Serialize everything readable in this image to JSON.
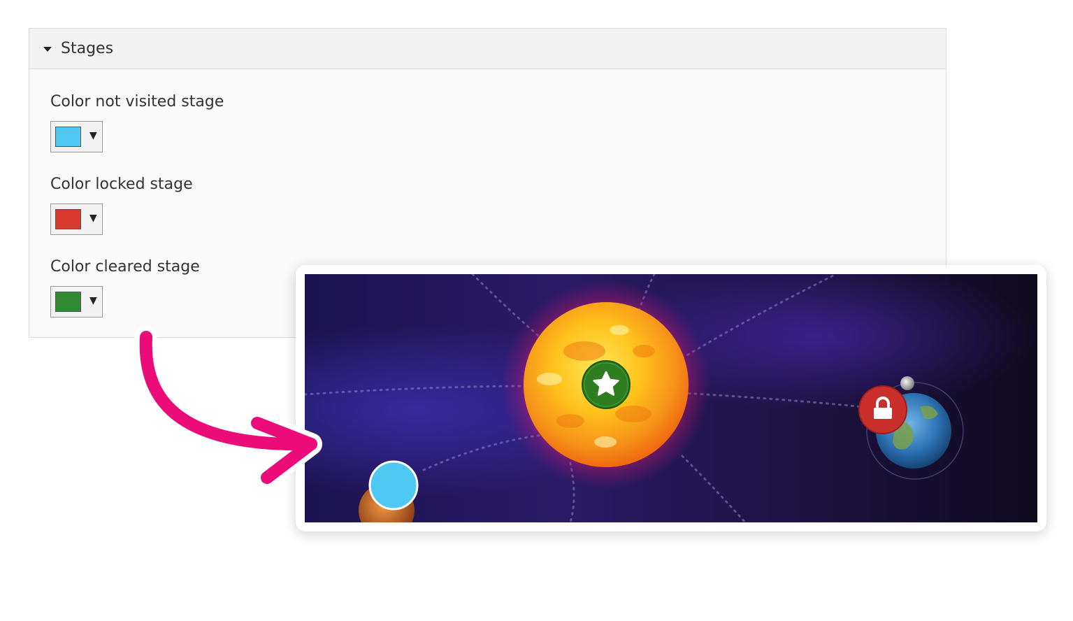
{
  "panel": {
    "title": "Stages",
    "fields": [
      {
        "label": "Color not visited stage",
        "color": "#4fc8f2"
      },
      {
        "label": "Color locked stage",
        "color": "#d93a30"
      },
      {
        "label": "Color cleared stage",
        "color": "#2f8a32"
      }
    ],
    "dropdown_glyph": "▼"
  },
  "preview": {
    "stages": [
      {
        "state": "not-visited",
        "color": "#4fc8f2",
        "icon": "none"
      },
      {
        "state": "cleared",
        "color": "#2f7d21",
        "icon": "star-icon"
      },
      {
        "state": "locked",
        "color": "#c9302c",
        "icon": "lock-icon"
      }
    ]
  },
  "colors": {
    "arrow": "#ec0c79",
    "space_dark": "#150a26",
    "space_purple": "#2a1b6e"
  }
}
